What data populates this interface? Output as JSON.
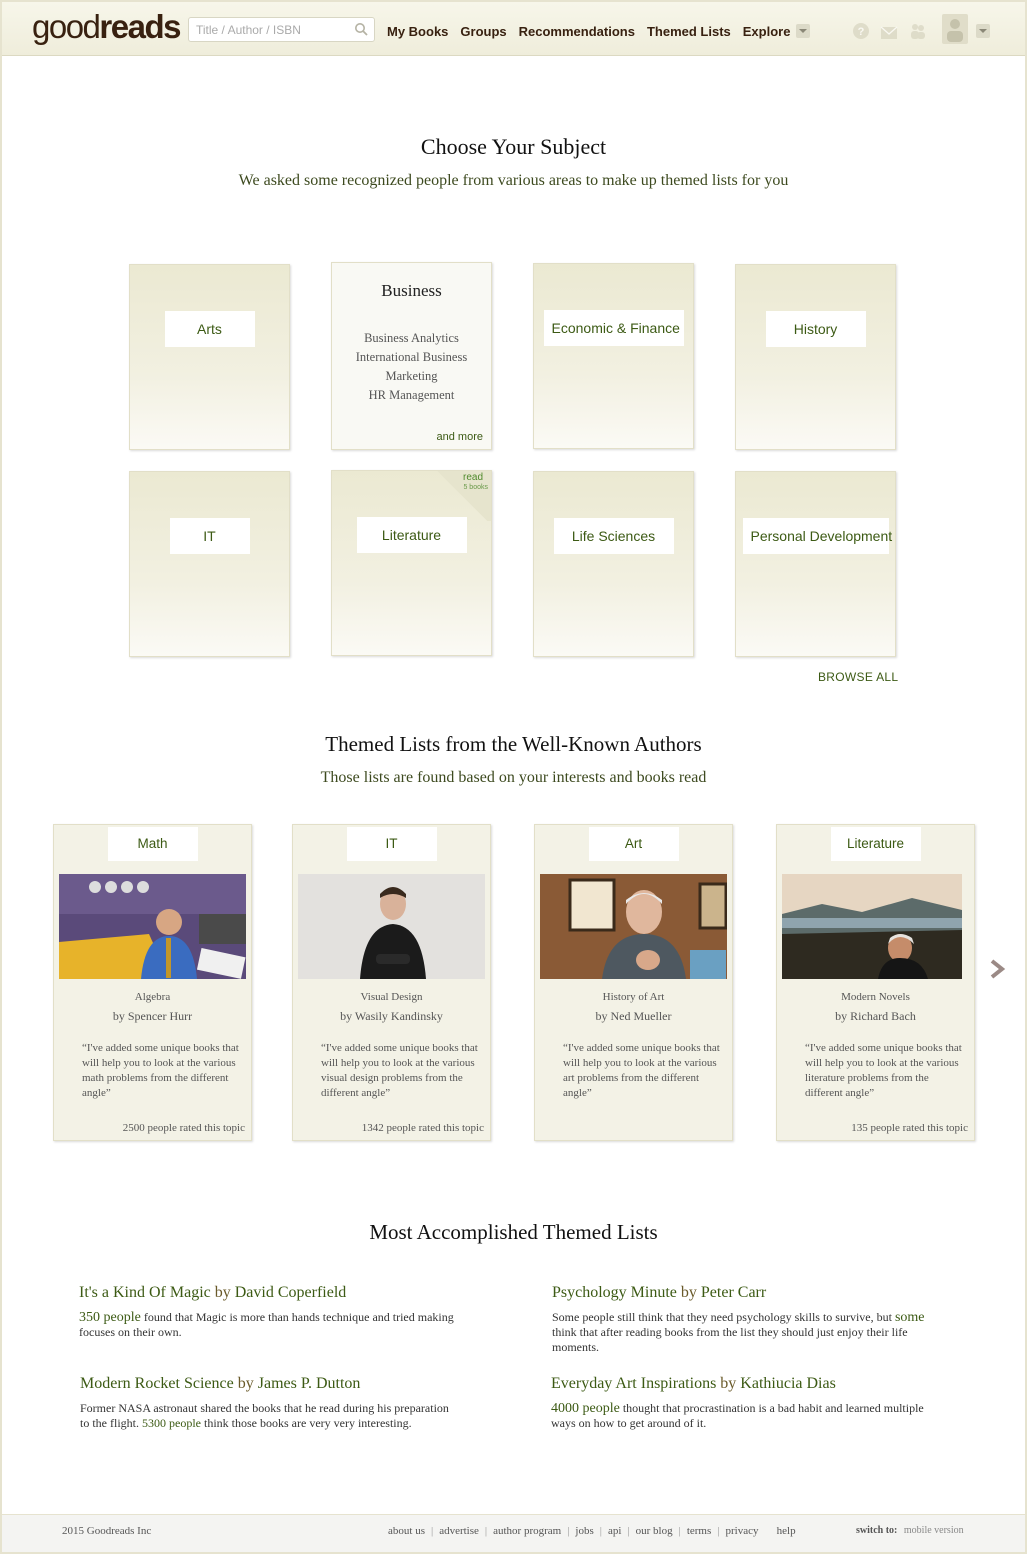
{
  "header": {
    "logo_light": "good",
    "logo_bold": "reads",
    "search_placeholder": "Title / Author / ISBN",
    "nav": [
      "My Books",
      "Groups",
      "Recommendations",
      "Themed Lists",
      "Explore"
    ],
    "icons": [
      "question-icon",
      "mail-icon",
      "friends-icon",
      "avatar-icon"
    ]
  },
  "subjects": {
    "title": "Choose Your Subject",
    "subtitle": "We asked some recognized people from various areas to make up themed lists for you",
    "tiles": [
      {
        "label": "Arts"
      },
      {
        "label": "Business",
        "items": [
          "Business Analytics",
          "International Business",
          "Marketing",
          "HR Management"
        ],
        "more": "and more"
      },
      {
        "label": "Economic & Finance"
      },
      {
        "label": "History"
      },
      {
        "label": "IT"
      },
      {
        "label": "Literature",
        "badge": "read",
        "badge_sub": "5 books"
      },
      {
        "label": "Life Sciences"
      },
      {
        "label": "Personal Development"
      }
    ],
    "browse_all": "BROWSE ALL"
  },
  "authors": {
    "title": "Themed Lists from the Well-Known Authors",
    "subtitle": "Those lists are found based on your interests and books read",
    "cards": [
      {
        "tag": "Math",
        "topic": "Algebra",
        "by": "by Spencer Hurr",
        "quote": "“I've added some unique books that will help you to look at the various math problems from the different angle”",
        "rated": "2500 people rated this topic"
      },
      {
        "tag": "IT",
        "topic": "Visual Design",
        "by": "by Wasily Kandinsky",
        "quote": "“I've added some unique books that will help you to look at the various visual design problems from the different angle”",
        "rated": "1342 people rated this topic"
      },
      {
        "tag": "Art",
        "topic": "History of Art",
        "by": "by Ned Mueller",
        "quote": "“I've added some unique books that will help you to look at the various art problems from the different angle”",
        "rated": ""
      },
      {
        "tag": "Literature",
        "topic": "Modern Novels",
        "by": "by Richard Bach",
        "quote": "“I've added some unique books that will help you to look at the various literature problems from the different angle”",
        "rated": "135 people rated this topic"
      }
    ]
  },
  "accomplished": {
    "title": "Most Accomplished Themed Lists",
    "items": [
      {
        "name": "It's a Kind Of Magic",
        "by": "by",
        "author": "David Coperfield",
        "lead": "350 people",
        "text": " found that Magic is more than hands technique and tried making focuses on their own."
      },
      {
        "name": "Psychology Minute",
        "by": "by",
        "author": "Peter Carr",
        "pre": "Some people still think that they need psychology skills to survive, but ",
        "lead": "some",
        "text": " think that after reading books from the list they should just enjoy their life moments."
      },
      {
        "name": "Modern Rocket Science",
        "by": "by",
        "author": "James P. Dutton",
        "pre": "Former NASA astronaut shared the books that he read during his preparation to the flight. ",
        "lead_small": "5300 people",
        "text": " think those books are very very interesting."
      },
      {
        "name": "Everyday Art Inspirations",
        "by": "by",
        "author": "Kathiucia Dias",
        "lead": "4000 people",
        "text": " thought that procrastination is a bad habit and learned multiple ways on how to get around of it."
      }
    ]
  },
  "footer": {
    "copyright": "2015 Goodreads Inc",
    "links": [
      "about us",
      "advertise",
      "author program",
      "jobs",
      "api",
      "our blog",
      "terms",
      "privacy",
      "help"
    ],
    "switch_label": "switch to:",
    "switch_value": "mobile version"
  },
  "colors": {
    "accent": "#3c5a14",
    "brand": "#382110",
    "header_bg": "#f4f3e4",
    "tile_bg": "#ebe9d2"
  }
}
